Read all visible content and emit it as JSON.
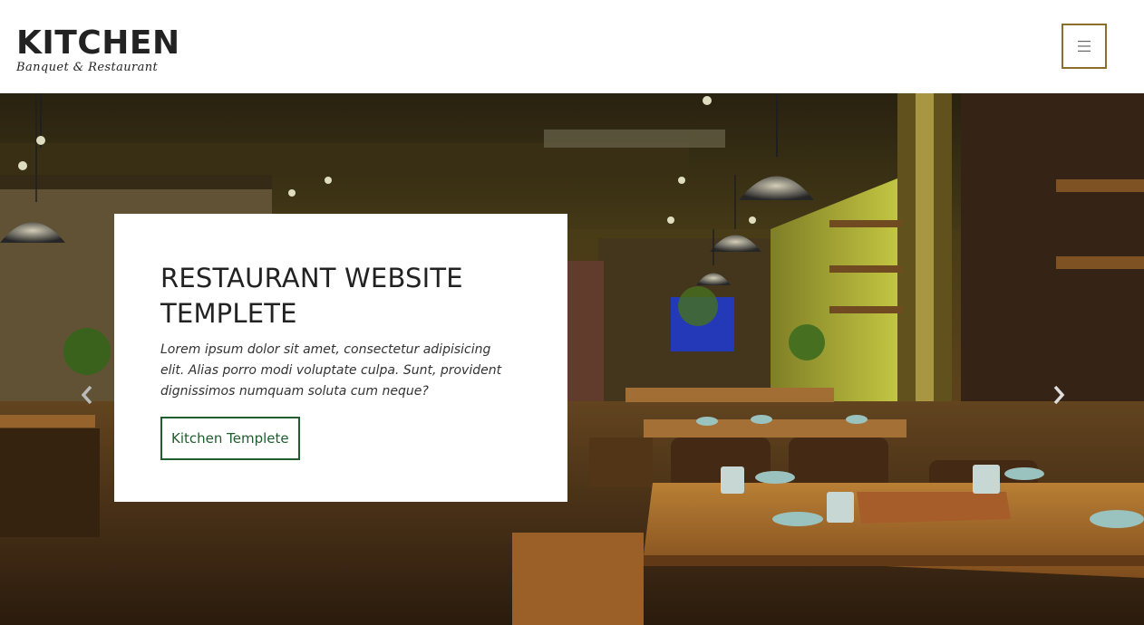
{
  "header": {
    "brand_name": "KITCHEN",
    "brand_tagline": "Banquet & Restaurant",
    "menu_icon": "hamburger-menu-icon",
    "accent_color": "#8a6d2f"
  },
  "hero": {
    "title": "RESTAURANT WEBSITE TEMPLETE",
    "description": "Lorem ipsum dolor sit amet, consectetur adipisicing elit. Alias porro modi voluptate culpa. Sunt, provident dignissimos numquam soluta cum neque?",
    "button_label": "Kitchen Templete",
    "button_color": "#1f5e2d",
    "prev_icon": "chevron-left-icon",
    "next_icon": "chevron-right-icon"
  }
}
